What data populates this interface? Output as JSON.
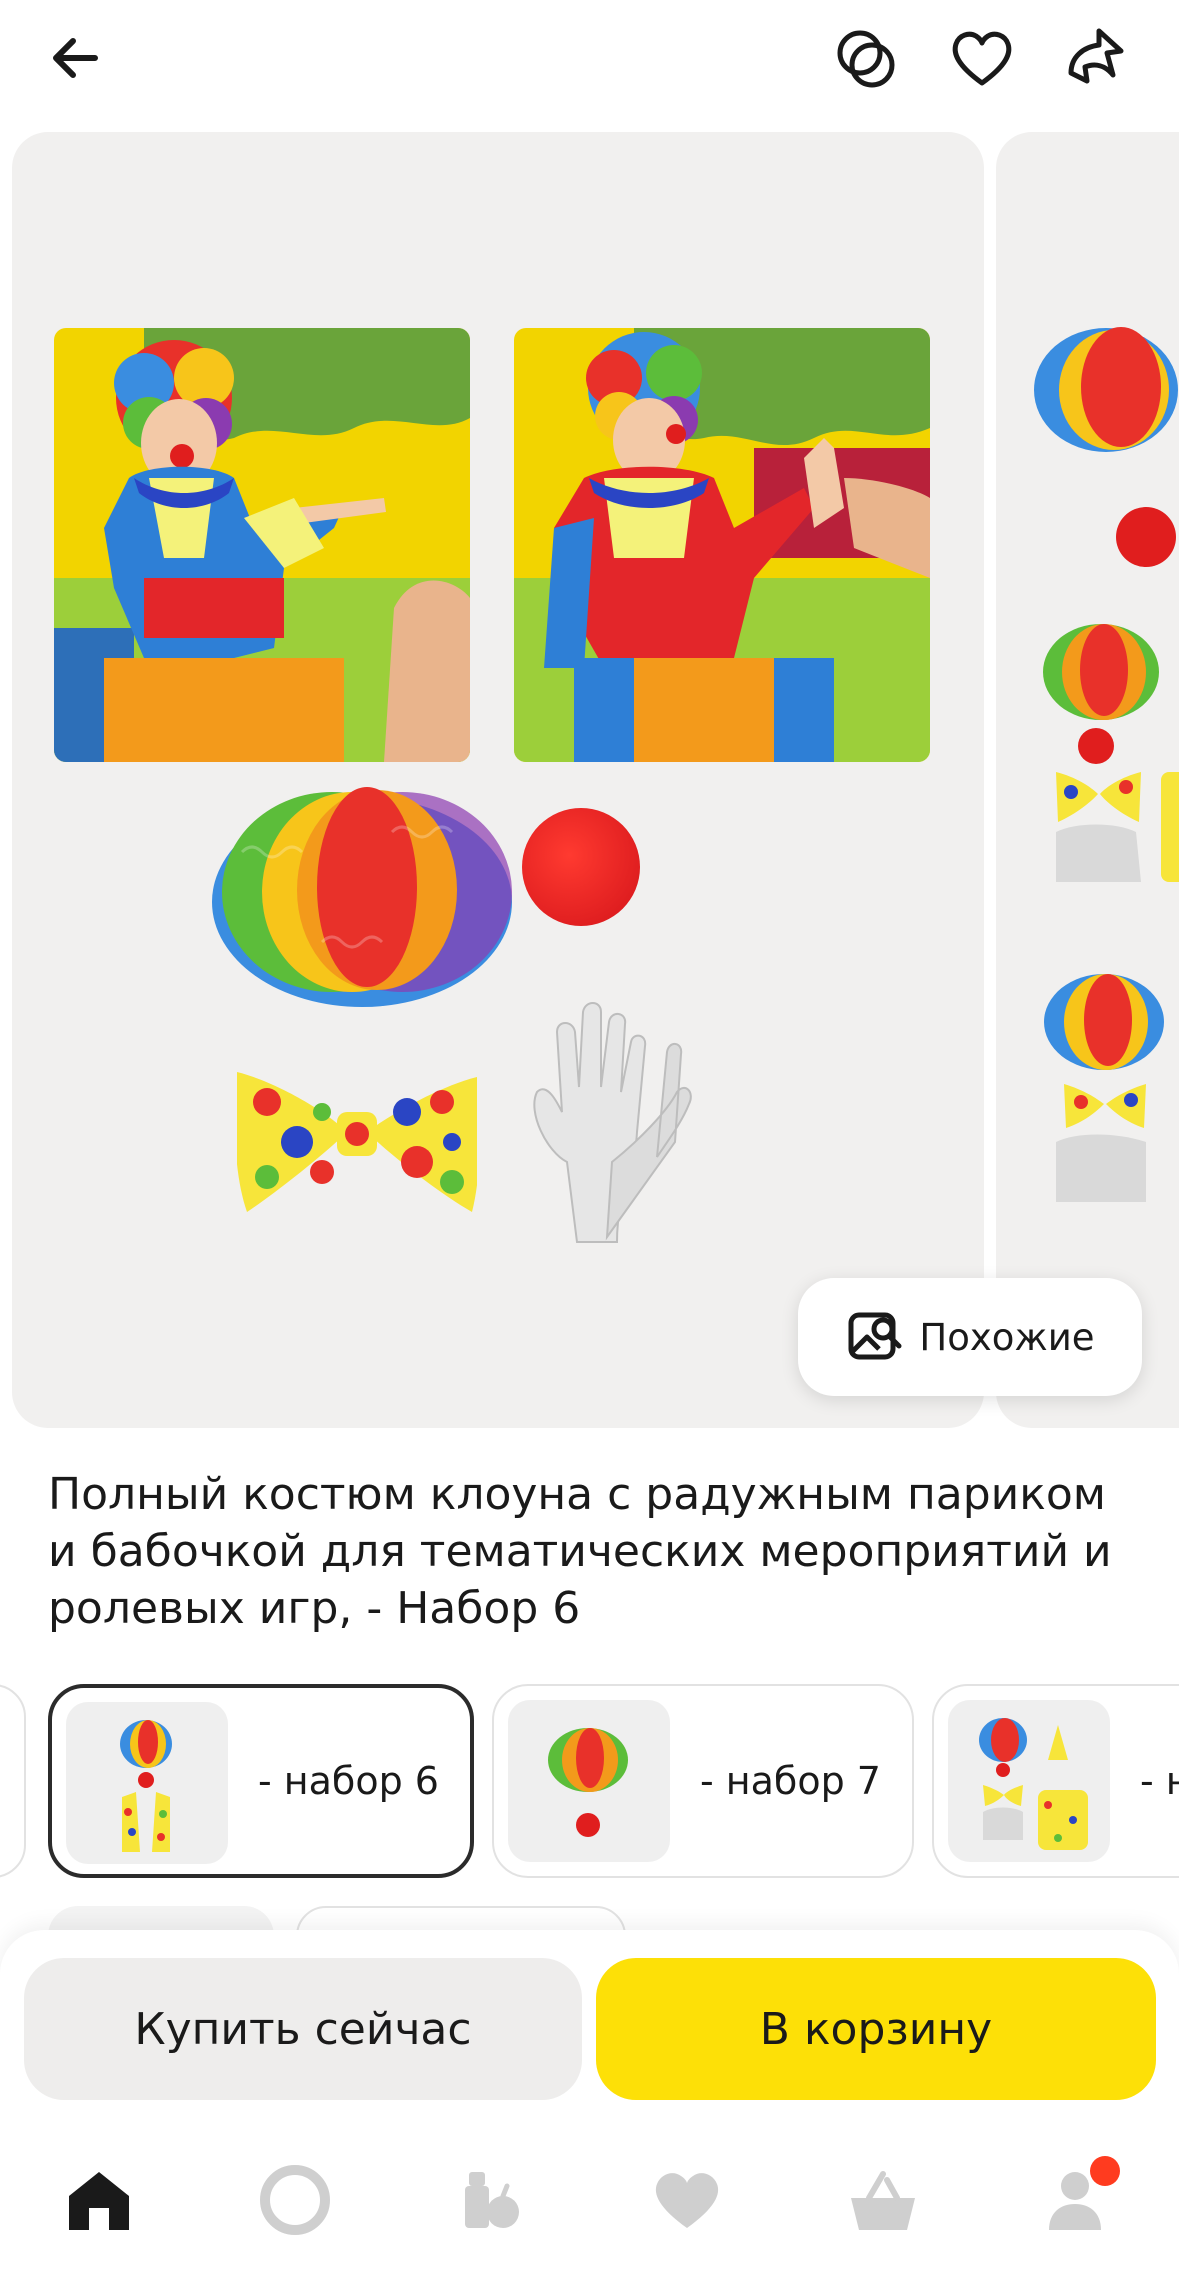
{
  "header": {
    "back_icon": "arrow-left-icon",
    "actions": [
      "compare-icon",
      "heart-icon",
      "share-icon"
    ]
  },
  "gallery": {
    "similar_label": "Похожие",
    "similar_icon": "image-search-icon"
  },
  "product": {
    "title": "Полный костюм клоуна с радужным париком и бабочкой для тематических мероприятий и ролевых игр, - Набор 6"
  },
  "variants": [
    {
      "label": "- набор 6",
      "selected": true
    },
    {
      "label": "- набор 7",
      "selected": false
    },
    {
      "label": "- н",
      "selected": false
    }
  ],
  "actions": {
    "buy_now": "Купить сейчас",
    "add_to_cart": "В корзину"
  },
  "tabbar": {
    "items": [
      "home-icon",
      "alice-icon",
      "catalog-icon",
      "favorites-icon",
      "cart-icon",
      "profile-icon"
    ]
  },
  "colors": {
    "accent_yellow": "#fde007",
    "card_bg": "#f1f0ef",
    "notification": "#ff3b1f"
  }
}
